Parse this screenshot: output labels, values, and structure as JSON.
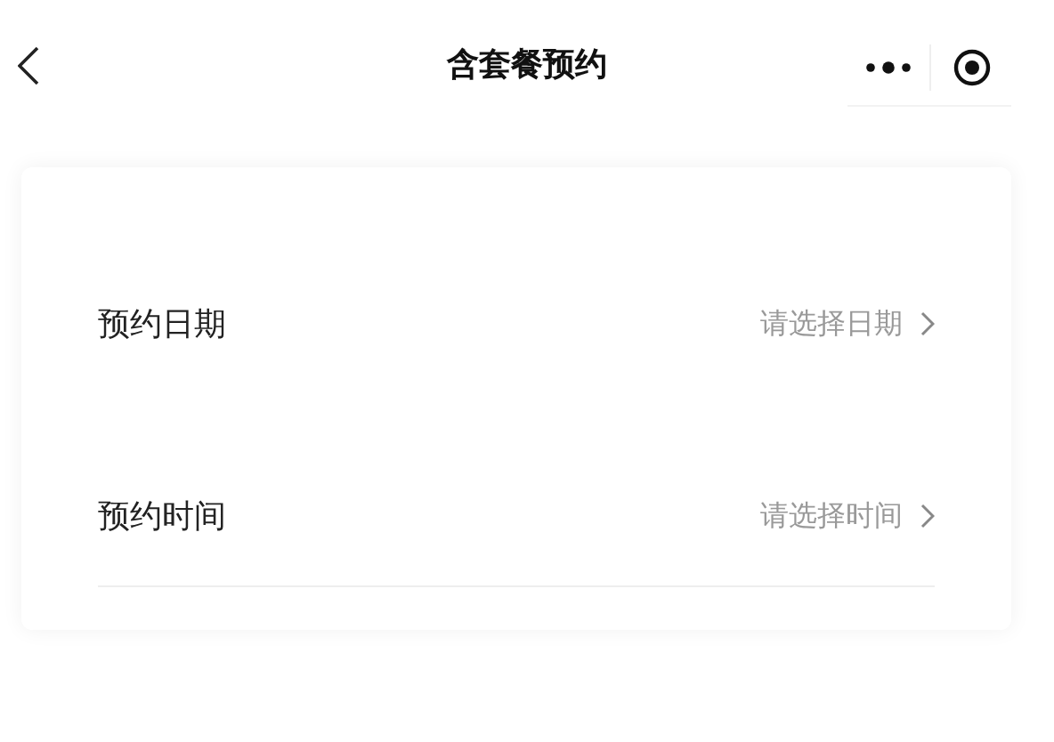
{
  "nav_bar": {
    "title": "含套餐预约"
  },
  "rows": [
    {
      "label": "预约日期",
      "placeholder": "请选择日期"
    },
    {
      "label": "预约时间",
      "placeholder": "请选择时间"
    }
  ]
}
